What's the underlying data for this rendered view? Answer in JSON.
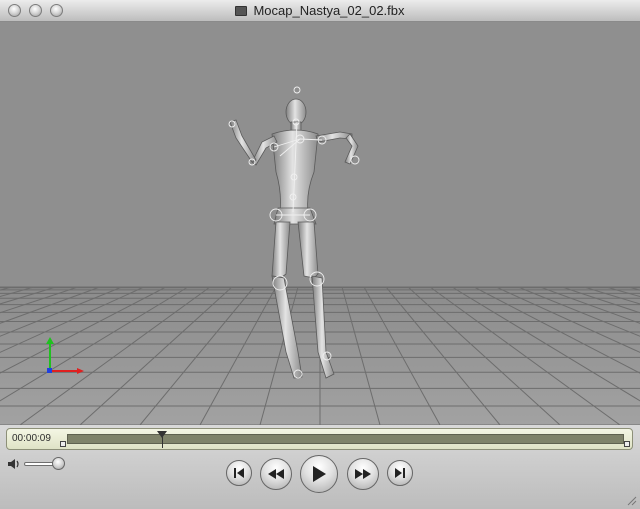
{
  "window": {
    "title": "Mocap_Nastya_02_02.fbx",
    "title_icon": "document-icon"
  },
  "viewport": {
    "background": "#8f8f8f",
    "floor_grid_color": "#6a6a6a",
    "axis_colors": {
      "x": "#e02020",
      "y": "#20c020",
      "origin": "#2040e0"
    },
    "figure_color": "#c8c8c8"
  },
  "playback": {
    "timecode": "00:00:09",
    "progress": 0.17,
    "volume": 0.85,
    "buttons": {
      "go_to_start": "skip-to-start-icon",
      "rewind": "rewind-icon",
      "play": "play-icon",
      "fast_forward": "fast-forward-icon",
      "go_to_end": "skip-to-end-icon"
    }
  }
}
